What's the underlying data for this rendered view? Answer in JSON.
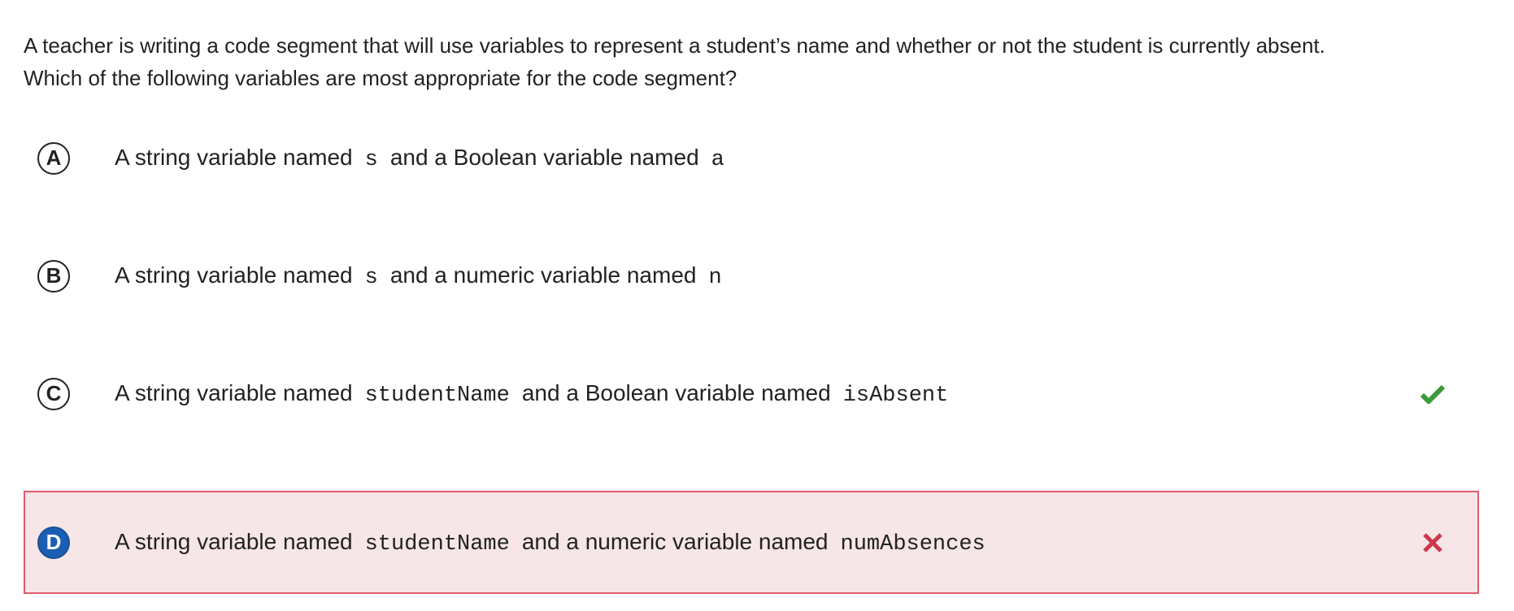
{
  "question": {
    "line1": "A teacher is writing a code segment that will use variables to represent a student’s name and whether or not the student is currently absent.",
    "line2": "Which of the following variables are most appropriate for the code segment?"
  },
  "choices": [
    {
      "letter": "A",
      "text_before": "A string variable named",
      "code1": "s",
      "text_middle": "and a Boolean variable named",
      "code2": "a",
      "status": "none"
    },
    {
      "letter": "B",
      "text_before": "A string variable named",
      "code1": "s",
      "text_middle": "and a numeric variable named",
      "code2": "n",
      "status": "none"
    },
    {
      "letter": "C",
      "text_before": "A string variable named",
      "code1": "studentName",
      "text_middle": "and a Boolean variable named",
      "code2": "isAbsent",
      "status": "correct",
      "status_icon": "checkmark-icon"
    },
    {
      "letter": "D",
      "text_before": "A string variable named",
      "code1": "studentName",
      "text_middle": "and a numeric variable named",
      "code2": "numAbsences",
      "status": "incorrect-selected",
      "status_icon": "x-mark-icon"
    }
  ],
  "colors": {
    "correct": "#3a9a3a",
    "incorrect": "#d0364a",
    "incorrect_bg": "#f6e6e8",
    "incorrect_border": "#e05a6c",
    "selected_letter_bg": "#1a5fb4"
  }
}
